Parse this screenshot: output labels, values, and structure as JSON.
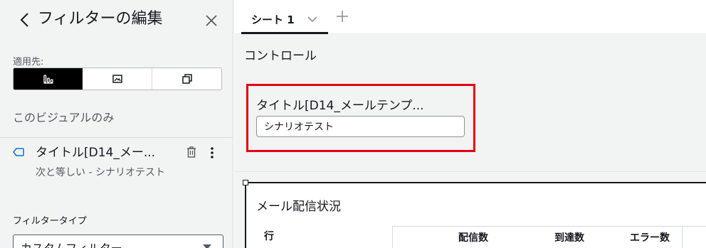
{
  "filter_panel": {
    "title": "フィルターの編集",
    "apply_label": "適用先:",
    "apply_options": [
      {
        "icon": "bar-chart-icon",
        "active": true
      },
      {
        "icon": "image-icon",
        "active": false
      },
      {
        "icon": "copy-icon",
        "active": false
      }
    ],
    "scope_text": "このビジュアルのみ",
    "filter": {
      "name": "タイトル[D14_メー...",
      "description": "次と等しい - シナリオテスト"
    },
    "filter_type_label": "フィルタータイプ",
    "filter_type_value": "カスタムフィルター"
  },
  "sheet_tabs": {
    "active_label": "シート 1"
  },
  "canvas": {
    "controls_title": "コントロール",
    "control": {
      "label": "タイトル[D14_メールテンプ...",
      "value": "シナリオテスト"
    },
    "visual": {
      "title": "メール配信状況",
      "row_header": "行",
      "columns": [
        "配信数",
        "到達数",
        "エラー数"
      ]
    }
  },
  "colors": {
    "highlight_border": "#e60012",
    "active_segment": "#000000",
    "panel_bg": "#f2f3f3"
  }
}
